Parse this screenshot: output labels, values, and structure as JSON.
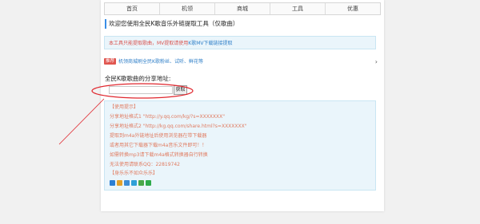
{
  "nav": {
    "items": [
      "首页",
      "机领",
      "商城",
      "工具",
      "优惠"
    ]
  },
  "title": "欢迎您使用全民K歌音乐外链提取工具（仅歌曲）",
  "notice": {
    "text": "本工具只能提取歌曲，MV提取请使用",
    "link": "K歌MV下载链接提取"
  },
  "promo": {
    "badge": "推荐",
    "text": "机领商城刷全民K歌粉丝、试听、鲜花等"
  },
  "share": {
    "label": "全民K歌歌曲的分享地址:",
    "input_value": "",
    "button": "获取"
  },
  "tips": {
    "heading": "【使用提示】",
    "lines": [
      "分享地址格式1 \"http://y.qq.com/kg/?s=XXXXXXX\"",
      "分享地址格式2 \"http://kg.qq.com/share.html?s=XXXXXXX\"",
      "提取到m4a外链地址后使用浏览器在带下载器",
      "或者用其它下载器下载m4a音乐文件即可！！",
      "如需转换mp3请下载m4a格式转换器自行转换",
      "无法使用请联系QQ：22819742"
    ],
    "footer": "【身乐乐不如众乐乐】"
  },
  "share_icons": [
    {
      "name": "qzone-icon",
      "color": "#2a7fd4"
    },
    {
      "name": "weibo-icon",
      "color": "#e2a12a"
    },
    {
      "name": "renren-icon",
      "color": "#3c8dd6"
    },
    {
      "name": "tencent-weibo-icon",
      "color": "#2fa0d8"
    },
    {
      "name": "douban-icon",
      "color": "#4aa84a"
    },
    {
      "name": "wechat-icon",
      "color": "#2fab4b"
    }
  ],
  "colors": {
    "accent": "#3a8ee6",
    "tip_text": "#e07a5f",
    "annotation": "#e0262d"
  }
}
